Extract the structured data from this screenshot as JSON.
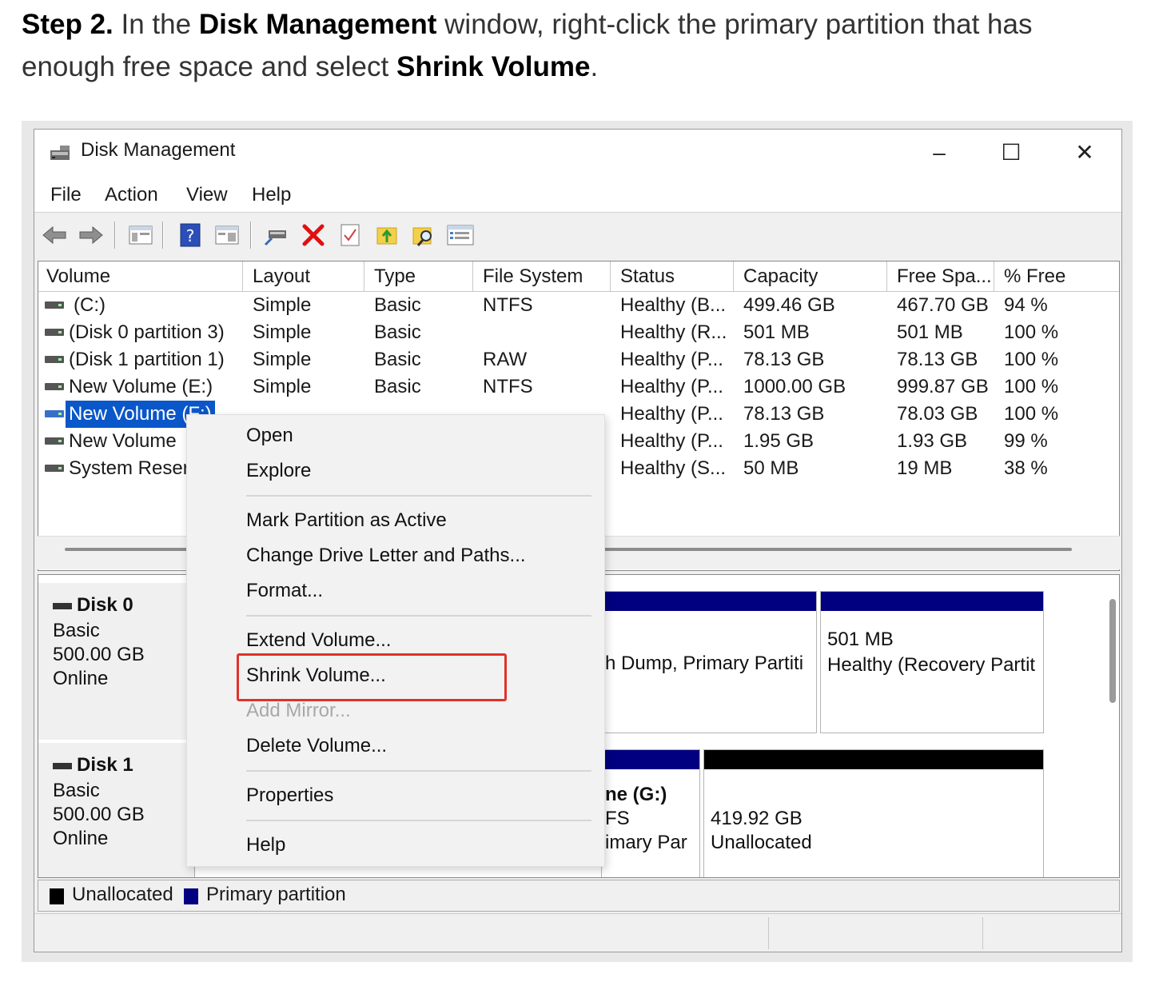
{
  "instruction": {
    "step": "Step 2.",
    "t1": "In the",
    "b1": "Disk Management",
    "t2": "window, right-click the primary partition that has enough free space and select",
    "b2": "Shrink Volume",
    "t3": "."
  },
  "window": {
    "title": "Disk Management",
    "controls": {
      "minimize": "–",
      "maximize": "☐",
      "close": "✕"
    }
  },
  "menu": [
    "File",
    "Action",
    "View",
    "Help"
  ],
  "columns": [
    "Volume",
    "Layout",
    "Type",
    "File System",
    "Status",
    "Capacity",
    "Free Spa...",
    "% Free"
  ],
  "volumes": [
    {
      "name": "(C:)",
      "layout": "Simple",
      "type": "Basic",
      "fs": "NTFS",
      "status": "Healthy (B...",
      "capacity": "499.46 GB",
      "free": "467.70 GB",
      "pct": "94 %"
    },
    {
      "name": "(Disk 0 partition 3)",
      "layout": "Simple",
      "type": "Basic",
      "fs": "",
      "status": "Healthy (R...",
      "capacity": "501 MB",
      "free": "501 MB",
      "pct": "100 %"
    },
    {
      "name": "(Disk 1 partition 1)",
      "layout": "Simple",
      "type": "Basic",
      "fs": "RAW",
      "status": "Healthy (P...",
      "capacity": "78.13 GB",
      "free": "78.13 GB",
      "pct": "100 %"
    },
    {
      "name": "New Volume (E:)",
      "layout": "Simple",
      "type": "Basic",
      "fs": "NTFS",
      "status": "Healthy (P...",
      "capacity": "1000.00 GB",
      "free": "999.87 GB",
      "pct": "100 %"
    },
    {
      "name": "New Volume (F:)",
      "layout": "",
      "type": "",
      "fs": "",
      "status": "Healthy (P...",
      "capacity": "78.13 GB",
      "free": "78.03 GB",
      "pct": "100 %"
    },
    {
      "name": "New Volume",
      "layout": "",
      "type": "",
      "fs": "",
      "status": "Healthy (P...",
      "capacity": "1.95 GB",
      "free": "1.93 GB",
      "pct": "99 %"
    },
    {
      "name": "System Reserv",
      "layout": "",
      "type": "",
      "fs": "",
      "status": "Healthy (S...",
      "capacity": "50 MB",
      "free": "19 MB",
      "pct": "38 %"
    }
  ],
  "disks": [
    {
      "name": "Disk 0",
      "type": "Basic",
      "size": "500.00 GB",
      "state": "Online"
    },
    {
      "name": "Disk 1",
      "type": "Basic",
      "size": "500.00 GB",
      "state": "Online"
    }
  ],
  "partitions": {
    "d0_mid": "h Dump, Primary Partiti",
    "d0_right_size": "501 MB",
    "d0_right_status": "Healthy (Recovery Partit",
    "d1_mid_name": "ne  (G:)",
    "d1_mid_fs": "FS",
    "d1_mid_status": "imary Par",
    "d1_right_size": "419.92 GB",
    "d1_right_status": "Unallocated"
  },
  "legend": {
    "unallocated": "Unallocated",
    "primary": "Primary partition"
  },
  "context_menu": {
    "open": "Open",
    "explore": "Explore",
    "mark_active": "Mark Partition as Active",
    "change_letter": "Change Drive Letter and Paths...",
    "format": "Format...",
    "extend": "Extend Volume...",
    "shrink": "Shrink Volume...",
    "add_mirror": "Add Mirror...",
    "delete": "Delete Volume...",
    "properties": "Properties",
    "help": "Help"
  },
  "colors": {
    "primary": "#000080",
    "unallocated": "#000000",
    "selection": "#0a57c9",
    "highlight": "#e0322b"
  }
}
